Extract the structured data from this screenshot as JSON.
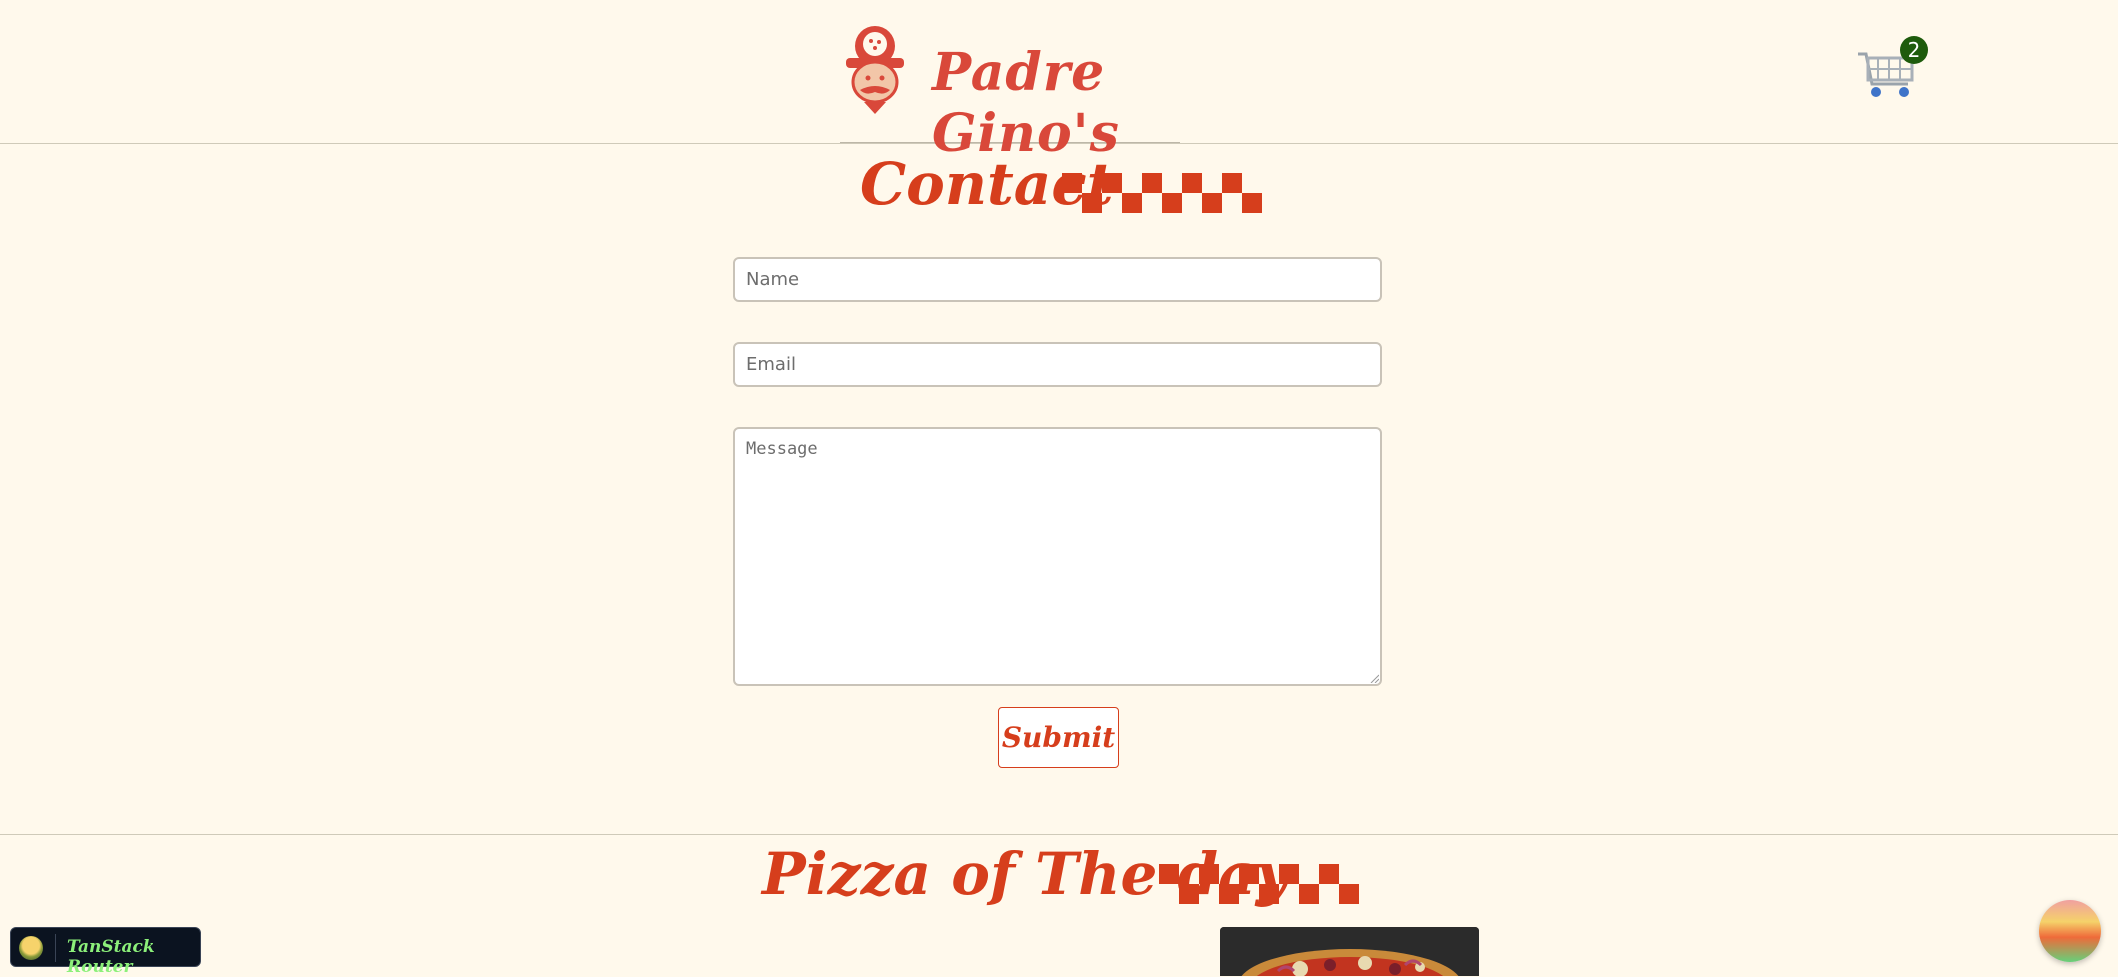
{
  "header": {
    "brand_name": "Padre Gino's",
    "cart_count": "2"
  },
  "contact": {
    "title": "Contact",
    "name_placeholder": "Name",
    "email_placeholder": "Email",
    "message_placeholder": "Message",
    "submit_label": "Submit"
  },
  "pizza_of_the_day": {
    "title": "Pizza of The day"
  },
  "devtools": {
    "label": "TanStack Router"
  },
  "colors": {
    "background": "#fff9ec",
    "accent": "#d63e1c",
    "cart_badge": "#1e5b0c"
  },
  "icons": [
    "chef-logo-icon",
    "cart-icon",
    "checker-pattern-icon",
    "tanstack-logo-icon"
  ]
}
